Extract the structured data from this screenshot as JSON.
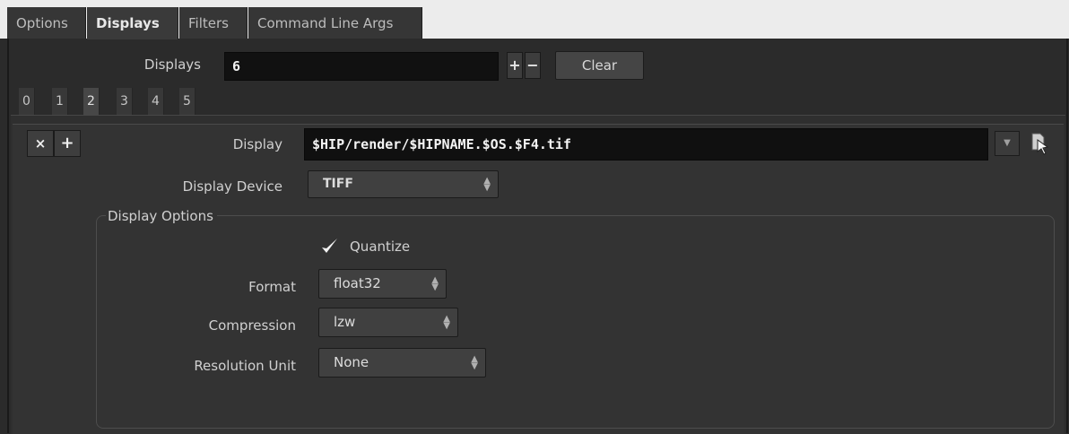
{
  "tabs": [
    {
      "label": "Options",
      "active": false
    },
    {
      "label": "Displays",
      "active": true
    },
    {
      "label": "Filters",
      "active": false
    },
    {
      "label": "Command Line Args",
      "active": false
    }
  ],
  "displays": {
    "label": "Displays",
    "count": "6",
    "add_label": "+",
    "remove_label": "−",
    "clear_label": "Clear"
  },
  "multiparm_tabs": [
    "0",
    "1",
    "2",
    "3",
    "4",
    "5"
  ],
  "active_multiparm_tab": "2",
  "instance": {
    "remove_label": "×",
    "insert_label": "+",
    "display_label": "Display",
    "display_value": "$HIP/render/$HIPNAME.$OS.$F4.tif",
    "display_menu_arrow": "▼",
    "file_chooser_icon": "file-chooser-icon",
    "device_label": "Display Device",
    "device_value": "TIFF"
  },
  "display_options": {
    "title": "Display Options",
    "quantize_label": "Quantize",
    "quantize_checked": true,
    "format_label": "Format",
    "format_value": "float32",
    "compression_label": "Compression",
    "compression_value": "lzw",
    "resolution_unit_label": "Resolution Unit",
    "resolution_unit_value": "None"
  },
  "colors": {
    "background": "#2b2b2b",
    "field_background": "#111111",
    "tab_strip": "#ececec"
  }
}
